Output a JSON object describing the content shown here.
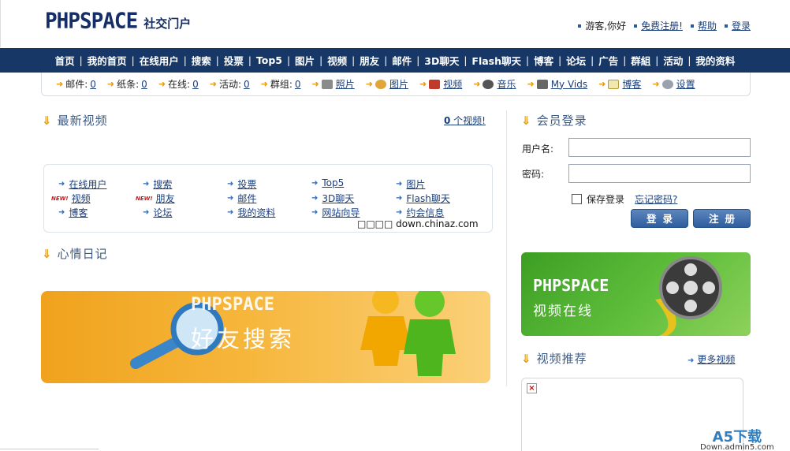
{
  "header": {
    "logo_text": "PHPSPACE",
    "logo_sub": "社交门户",
    "guest_text": "游客,你好",
    "register_link": "免费注册!",
    "help_link": "帮助",
    "login_link": "登录"
  },
  "nav": {
    "items": [
      "首页",
      "我的首页",
      "在线用户",
      "搜索",
      "投票",
      "Top5",
      "图片",
      "视频",
      "朋友",
      "邮件",
      "3D聊天",
      "Flash聊天",
      "博客",
      "论坛",
      "广告",
      "群組",
      "活动",
      "我的资料"
    ]
  },
  "status": {
    "mail_label": "邮件:",
    "mail_value": "0",
    "notes_label": "纸条:",
    "notes_value": "0",
    "online_label": "在线:",
    "online_value": "0",
    "activity_label": "活动:",
    "activity_value": "0",
    "group_label": "群组:",
    "group_value": "0",
    "photo_link": "照片",
    "picture_link": "图片",
    "video_link": "视频",
    "music_link": "音乐",
    "myvids_link": "My Vids",
    "blog_link": "博客",
    "settings_link": "设置"
  },
  "latest_videos": {
    "title": "最新视频",
    "count_num": "0",
    "count_suffix": " 个视频!"
  },
  "link_grid": {
    "badge": "NEW!",
    "items": [
      "在线用户",
      "搜索",
      "投票",
      "Top5",
      "图片",
      "视频",
      "朋友",
      "邮件",
      "3D聊天",
      "Flash聊天",
      "博客",
      "论坛",
      "我的资料",
      "网站向导",
      "约会信息"
    ]
  },
  "watermark": "□□□□ down.chinaz.com",
  "mood_diary": {
    "title": "心情日记"
  },
  "banner_search": {
    "logo": "PHPSPACE",
    "subtitle": "好友搜索"
  },
  "login": {
    "title": "会员登录",
    "username_label": "用户名:",
    "password_label": "密码:",
    "remember_label": "保存登录",
    "forgot_link": "忘记密码?",
    "login_button": "登录",
    "register_button": "注册"
  },
  "banner_video": {
    "logo": "PHPSPACE",
    "subtitle": "视频在线"
  },
  "recommended": {
    "title": "视频推荐",
    "more_link": "更多视频"
  },
  "a5": {
    "main": "A5下载",
    "sub": "Down.admin5.com"
  },
  "colors": {
    "nav_bg": "#173866",
    "accent_orange": "#e39a17",
    "link_blue": "#1a3e7a",
    "banner_orange": "#f0a21d",
    "banner_green": "#3c9e24"
  }
}
